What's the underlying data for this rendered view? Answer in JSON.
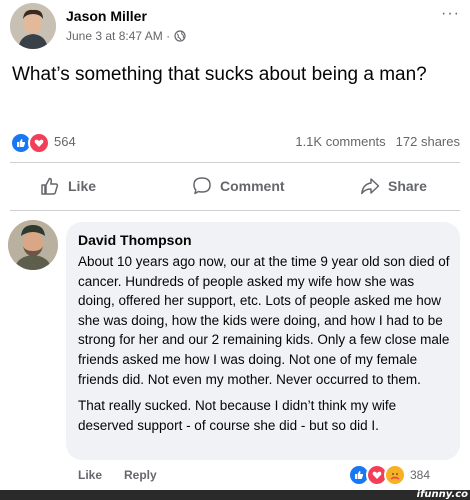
{
  "post": {
    "author": "Jason Miller",
    "timestamp": "June 3 at 8:47 AM ·",
    "more_label": "···",
    "text": "What’s something that sucks about being a man?",
    "reaction_count": "564",
    "comments_count": "1.1K comments",
    "shares_count": "172 shares"
  },
  "actions": {
    "like": "Like",
    "comment": "Comment",
    "share": "Share"
  },
  "comment": {
    "author": "David Thompson",
    "paragraph1": "About 10 years ago now, our at the time 9 year old son died of cancer. Hundreds of people asked my wife how she was doing, offered her support, etc. Lots of people asked me how she was doing, how the kids were doing, and how I had to be strong for her and our 2 remaining kids. Only a few close male friends asked me how I was doing. Not one of my female friends did. Not even my mother. Never occurred to them.",
    "paragraph2": "That really sucked. Not because I didn’t think my wife deserved support - of course she did - but so did I.",
    "like_label": "Like",
    "reply_label": "Reply",
    "reaction_count": "384"
  },
  "watermark": "ifunny.co",
  "colors": {
    "like_blue": "#1877f2",
    "love_red": "#f33e58",
    "care_yellow": "#f7b125",
    "muted_text": "#65676b",
    "bubble_bg": "#f0f2f5"
  },
  "icons": [
    "globe-icon",
    "more-icon",
    "like-reaction-icon",
    "love-reaction-icon",
    "care-reaction-icon",
    "thumbs-up-icon",
    "comment-icon",
    "share-icon"
  ]
}
